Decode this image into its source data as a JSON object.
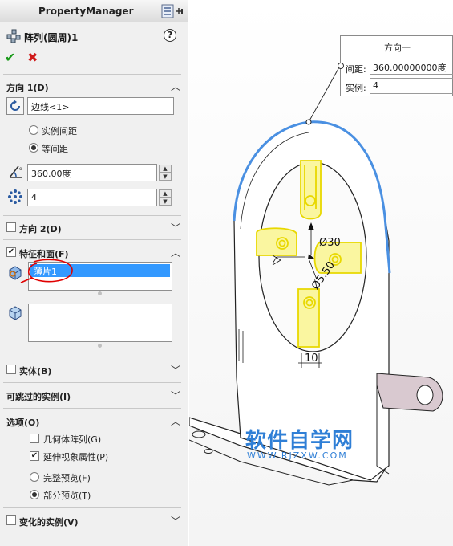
{
  "header": {
    "title": "PropertyManager"
  },
  "feature": {
    "title": "阵列(圆周)1"
  },
  "direction1": {
    "label": "方向 1(D)",
    "edge_value": "边线<1>",
    "options": [
      {
        "label": "实例间距",
        "selected": false
      },
      {
        "label": "等间距",
        "selected": true
      }
    ],
    "angle_value": "360.00度",
    "count_value": "4"
  },
  "direction2": {
    "label": "方向 2(D)",
    "checked": false
  },
  "features_faces": {
    "label": "特征和面(F)",
    "checked": true,
    "features": [
      "薄片1"
    ]
  },
  "bodies": {
    "label": "实体(B)",
    "checked": false
  },
  "skip_instances": {
    "label": "可跳过的实例(I)"
  },
  "options": {
    "label": "选项(O)",
    "geometry_pattern": {
      "label": "几何体阵列(G)",
      "checked": false
    },
    "propagate_visual": {
      "label": "延伸视象属性(P)",
      "checked": true
    },
    "preview": [
      {
        "label": "完整预览(F)",
        "selected": false
      },
      {
        "label": "部分预览(T)",
        "selected": true
      }
    ]
  },
  "varied_instances": {
    "label": "变化的实例(V)",
    "checked": false
  },
  "callout": {
    "title": "方向一",
    "spacing_label": "间距:",
    "spacing_value": "360.00000000度",
    "count_label": "实例:",
    "count_value": "4"
  },
  "dimensions": {
    "d1": "Ø30",
    "d2": "Ø5.50",
    "d3": "10"
  },
  "watermark": {
    "text": "软件自学网",
    "url": "WWW.RJZXW.COM"
  },
  "colors": {
    "selection": "#3399ff",
    "edge_highlight": "#4a90e2",
    "preview": "#f5f04a",
    "watermark": "#2f7fd6"
  }
}
